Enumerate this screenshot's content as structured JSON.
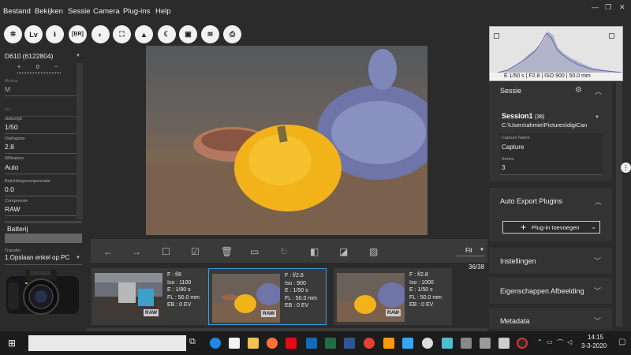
{
  "menu": {
    "items": [
      "Bestand",
      "Bekijken",
      "Sessie",
      "Camera",
      "Plug-ins",
      "Help"
    ]
  },
  "toolbar": {
    "lv_label": "Lv",
    "br_label": "[BR]"
  },
  "left_panel": {
    "camera_model": "D610 (6122804)",
    "exposure_readout": "0",
    "modus_label": "Modus",
    "modus_value": "M",
    "iso_label": "Iso",
    "sluitertijd_label": "sluitertijd",
    "sluitertijd_value": "1/50",
    "diafragma_label": "Diafragma",
    "diafragma_value": "2.8",
    "witbalans_label": "Witbalans",
    "witbalans_value": "Auto",
    "belichting_label": "Belichtingscompensatie",
    "belichting_value": "0.0",
    "compressie_label": "Compressie",
    "compressie_value": "RAW",
    "batterij_label": "Batterij",
    "transfer_label": "Transfer",
    "transfer_value": "1.Opslaan enkel op PC"
  },
  "navbar": {
    "zoom_value": "Fit",
    "counter": "36/38"
  },
  "thumbnails": [
    {
      "f": "F : f/8",
      "iso": "Iso : 1100",
      "e": "E : 1/80 s",
      "fl": "FL : 50.0 mm",
      "eb": "EB : 0 EV",
      "raw": "RAW"
    },
    {
      "f": "F : f/2.8",
      "iso": "Iso : 900",
      "e": "E : 1/50 s",
      "fl": "FL : 50.0 mm",
      "eb": "EB : 0 EV",
      "raw": "RAW"
    },
    {
      "f": "F : f/2.8",
      "iso": "Iso : 1000",
      "e": "E : 1/50 s",
      "fl": "FL : 50.0 mm",
      "eb": "EB : 0 EV",
      "raw": "RAW"
    }
  ],
  "histogram": {
    "caption": "E 1/50 s | F2.8 | ISO 900 | 50.0 mm"
  },
  "session": {
    "title": "Sessie",
    "name": "Session1",
    "count": "(36)",
    "path": "C:\\Users\\ahmie\\Pictures\\digiCan",
    "capture_name_label": "Capture Name",
    "capture_name_value": "Capture",
    "series_label": "Series",
    "series_value": "3"
  },
  "auto_export": {
    "title": "Auto Export Plugins",
    "add_button": "Plug-in toevoegen"
  },
  "sections": {
    "instellingen": "Instellingen",
    "eigenschappen": "Eigenschappen Afbeelding",
    "metadata": "Metadata"
  },
  "taskbar": {
    "time": "14:15",
    "date": "3-3-2020"
  },
  "colors": {
    "accent": "#3aa0d8",
    "bg": "#2b2b2b",
    "panel": "#333333"
  }
}
